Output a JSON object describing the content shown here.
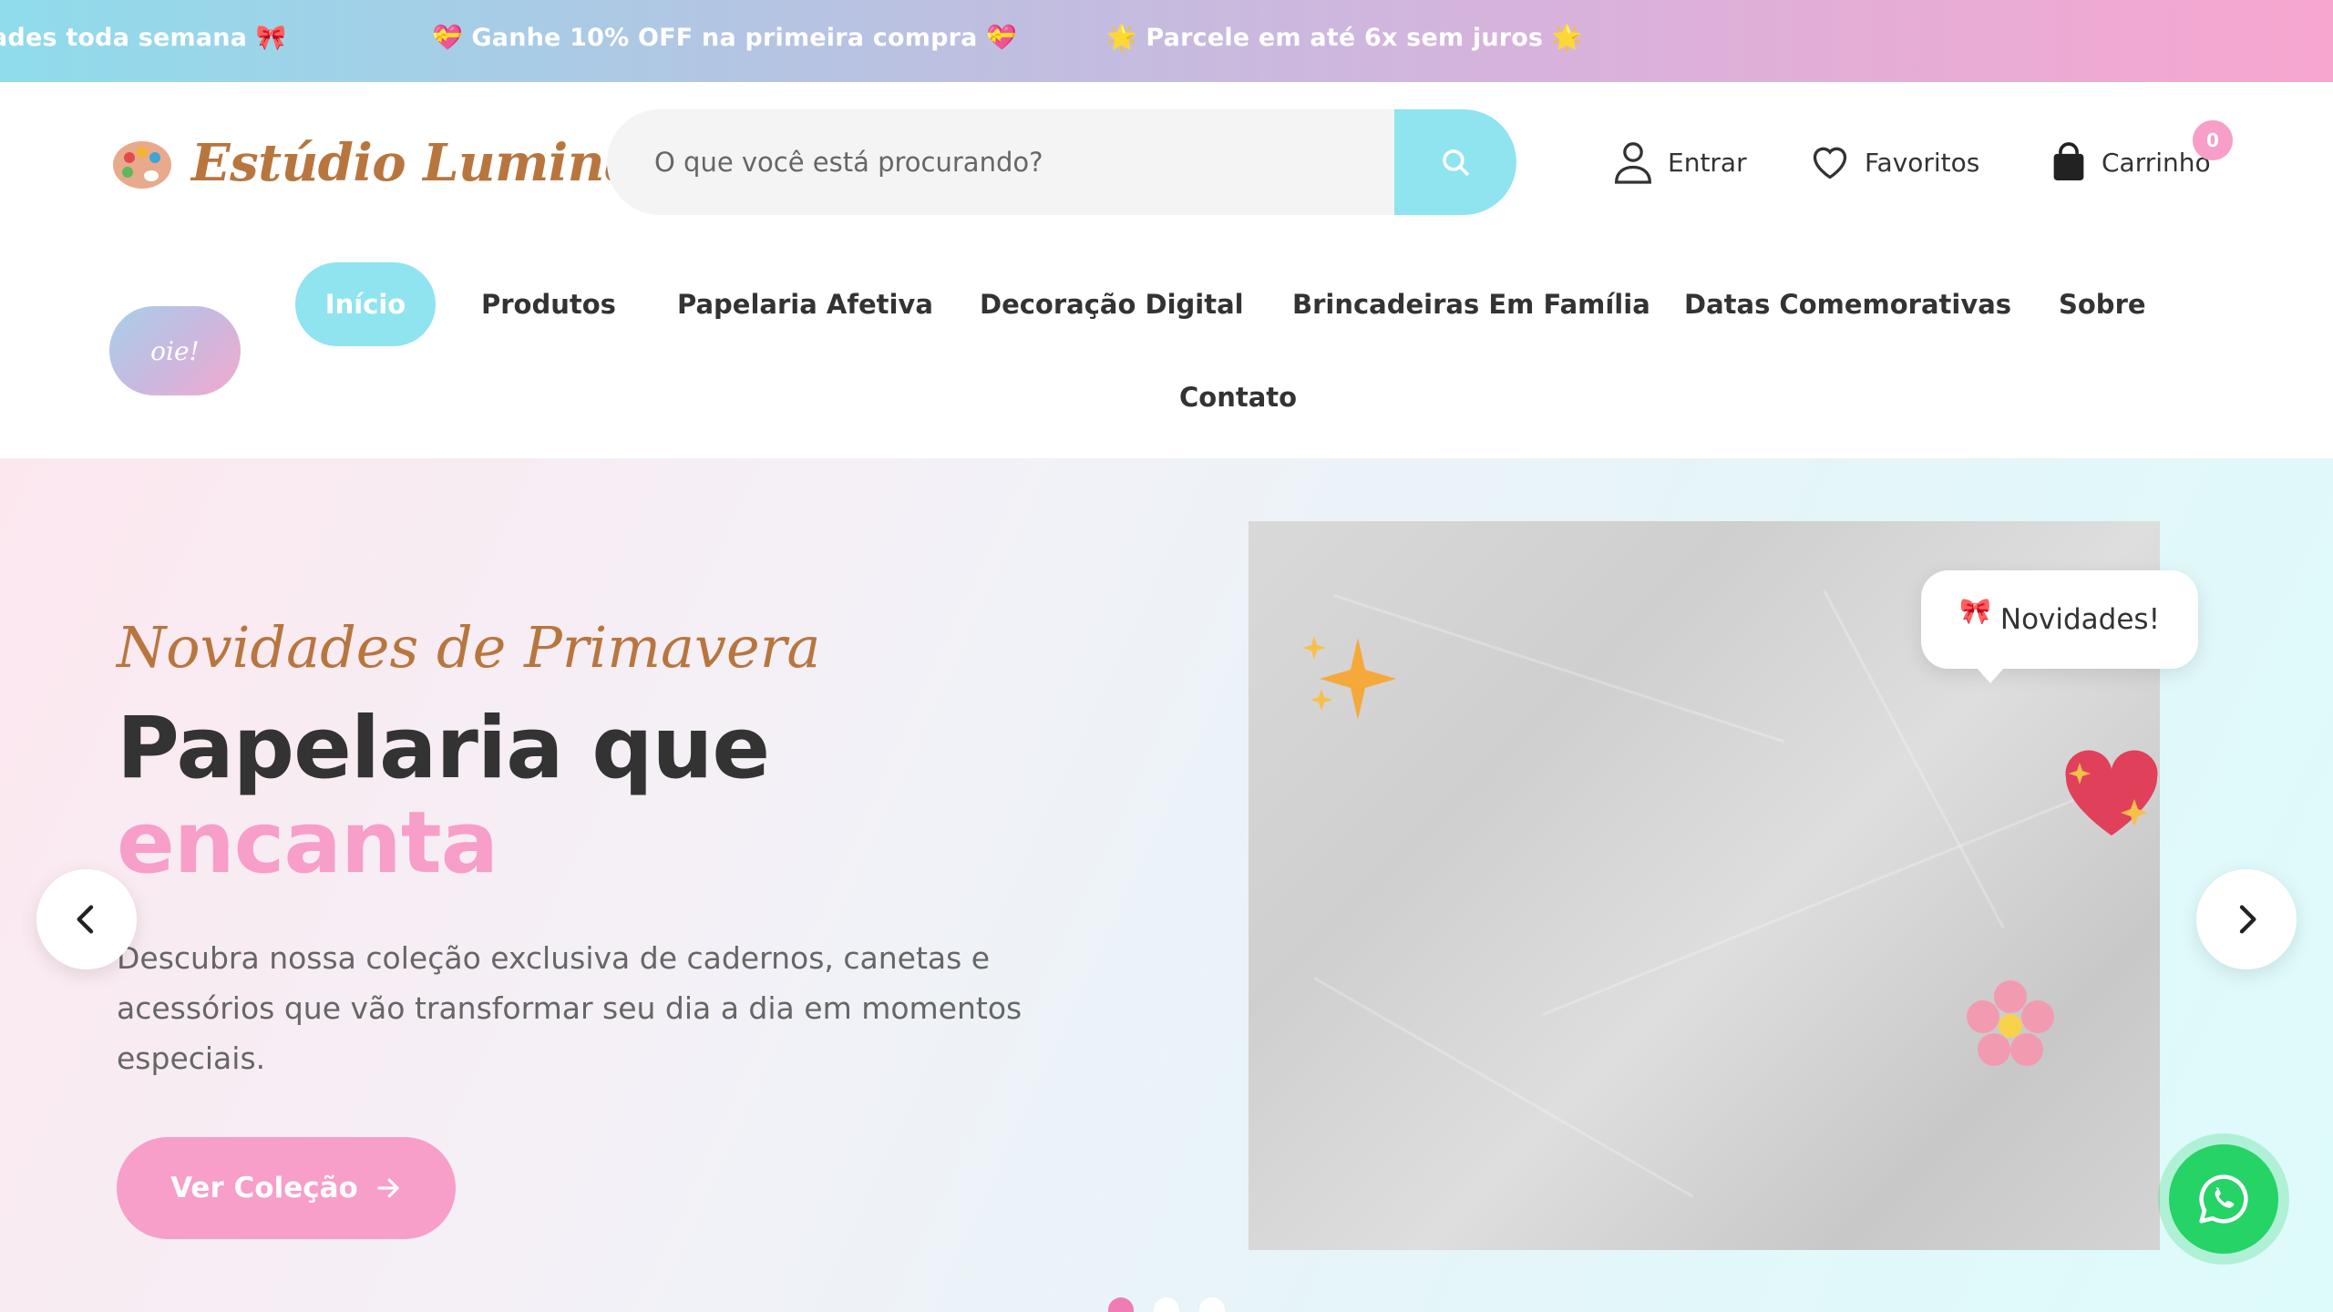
{
  "announcements": [
    "ades toda semana 🎀",
    "💝 Ganhe 10% OFF na primeira compra 💝",
    "🌟 Parcele em até 6x sem juros 🌟"
  ],
  "header": {
    "logo_text": "Estúdio Lumina",
    "search_placeholder": "O que você está procurando?",
    "login_label": "Entrar",
    "favorites_label": "Favoritos",
    "cart_label": "Carrinho",
    "cart_count": "0"
  },
  "nav": {
    "badge_text": "oie!",
    "items": [
      "Início",
      "Produtos",
      "Papelaria Afetiva",
      "Decoração Digital",
      "Brincadeiras Em Família",
      "Datas Comemorativas",
      "Sobre",
      "Contato"
    ],
    "active": "Início"
  },
  "hero": {
    "kicker": "Novidades de Primavera",
    "title_line1": "Papelaria que",
    "title_line2": "encanta",
    "description": "Descubra nossa coleção exclusiva de cadernos, canetas e acessórios que vão transformar seu dia a dia em momentos especiais.",
    "cta_label": "Ver Coleção",
    "bubble_text": "Novidades!",
    "slides_total": 3,
    "active_slide": 1
  },
  "colors": {
    "accent_pink": "#f79ec9",
    "accent_cyan": "#8fe4ef",
    "brand_brown": "#b8763f",
    "whatsapp_green": "#25d366"
  }
}
